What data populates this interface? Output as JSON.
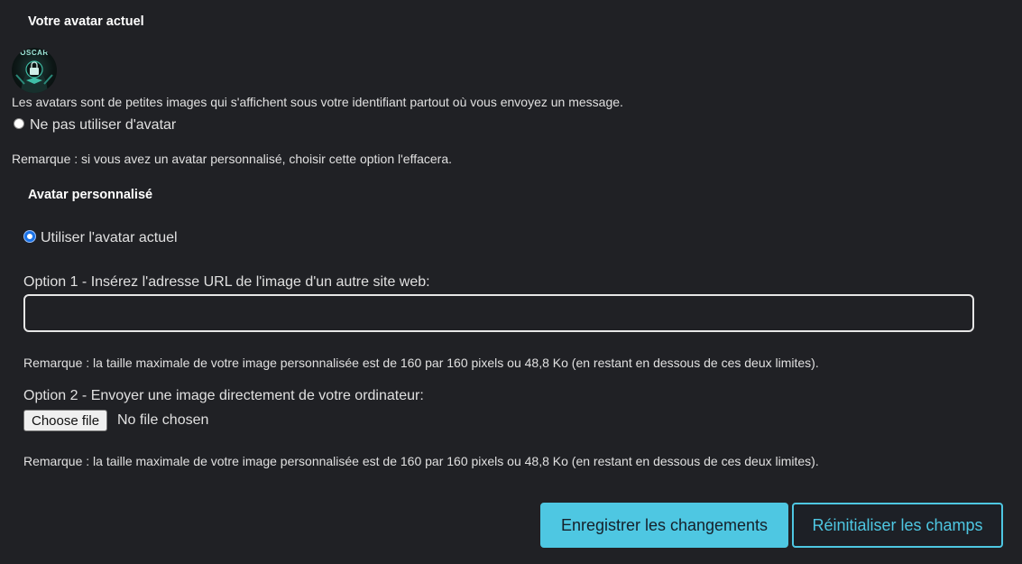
{
  "current_avatar": {
    "title": "Votre avatar actuel",
    "avatar_text": "OSCAR",
    "description": "Les avatars sont de petites images qui s'affichent sous votre identifiant partout où vous envoyez un message."
  },
  "no_avatar": {
    "label": "Ne pas utiliser d'avatar",
    "checked": false,
    "note": "Remarque : si vous avez un avatar personnalisé, choisir cette option l'effacera."
  },
  "custom_avatar": {
    "title": "Avatar personnalisé",
    "use_current_label": "Utiliser l'avatar actuel",
    "use_current_checked": true,
    "option1_label": "Option 1 - Insérez l'adresse URL de l'image d'un autre site web:",
    "url_value": "",
    "url_placeholder": "",
    "option1_note": "Remarque : la taille maximale de votre image personnalisée est de 160 par 160 pixels ou 48,8 Ko (en restant en dessous de ces deux limites).",
    "option2_label": "Option 2 - Envoyer une image directement de votre ordinateur:",
    "choose_file_label": "Choose file",
    "no_file_text": "No file chosen",
    "option2_note": "Remarque : la taille maximale de votre image personnalisée est de 160 par 160 pixels ou 48,8 Ko (en restant en dessous de ces deux limites)."
  },
  "actions": {
    "save_label": "Enregistrer les changements",
    "reset_label": "Réinitialiser les champs"
  },
  "colors": {
    "background": "#202125",
    "accent": "#4ec7e2",
    "text": "#e6e6e6"
  }
}
